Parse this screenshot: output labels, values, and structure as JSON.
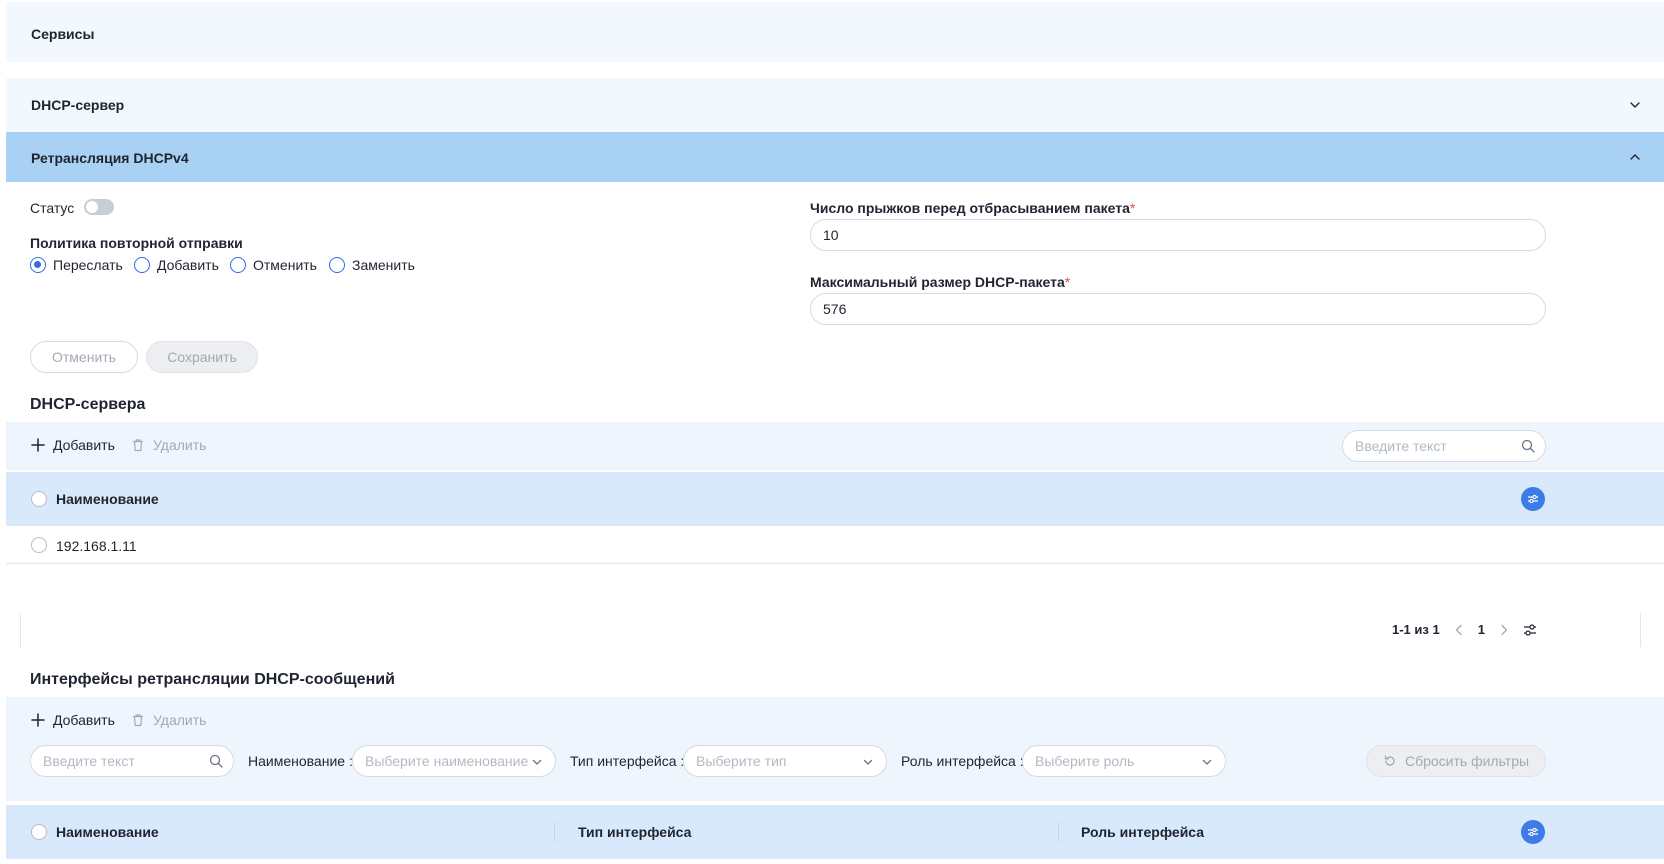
{
  "page": {
    "title": "Сервисы"
  },
  "accordions": {
    "dhcp_server": {
      "label": "DHCP-сервер",
      "icon": "chevron-down-icon"
    },
    "dhcp_relay": {
      "label": "Ретрансляция DHCPv4",
      "icon": "chevron-up-icon"
    }
  },
  "relay_form": {
    "status_label": "Статус",
    "status_on": false,
    "policy_label": "Политика повторной отправки",
    "policy_options": [
      "Переслать",
      "Добавить",
      "Отменить",
      "Заменить"
    ],
    "policy_selected": "Переслать",
    "hops_label": "Число прыжков перед отбрасыванием пакета",
    "hops_value": "10",
    "max_size_label": "Максимальный размер DHCP-пакета",
    "max_size_value": "576",
    "required_mark": "*",
    "cancel_label": "Отменить",
    "save_label": "Сохранить"
  },
  "dhcp_servers": {
    "title": "DHCP-сервера",
    "add_label": "Добавить",
    "delete_label": "Удалить",
    "search_placeholder": "Введите текст",
    "columns": [
      "Наименование"
    ],
    "rows": [
      {
        "name": "192.168.1.11"
      }
    ],
    "pagination": {
      "range": "1-1 из 1",
      "page": "1"
    }
  },
  "relay_interfaces": {
    "title": "Интерфейсы ретрансляции DHCP-сообщений",
    "add_label": "Добавить",
    "delete_label": "Удалить",
    "search_placeholder": "Введите текст",
    "filters": [
      {
        "label": "Наименование :",
        "placeholder": "Выберите наименование"
      },
      {
        "label": "Тип интерфейса :",
        "placeholder": "Выберите тип"
      },
      {
        "label": "Роль интерфейса :",
        "placeholder": "Выберите роль"
      }
    ],
    "reset_label": "Сбросить фильтры",
    "columns": [
      "Наименование",
      "Тип интерфейса",
      "Роль интерфейса"
    ]
  },
  "colors": {
    "accent": "#2f6de1",
    "accordion_active": "#a9d1f3",
    "table_header": "#d7e9fa"
  }
}
